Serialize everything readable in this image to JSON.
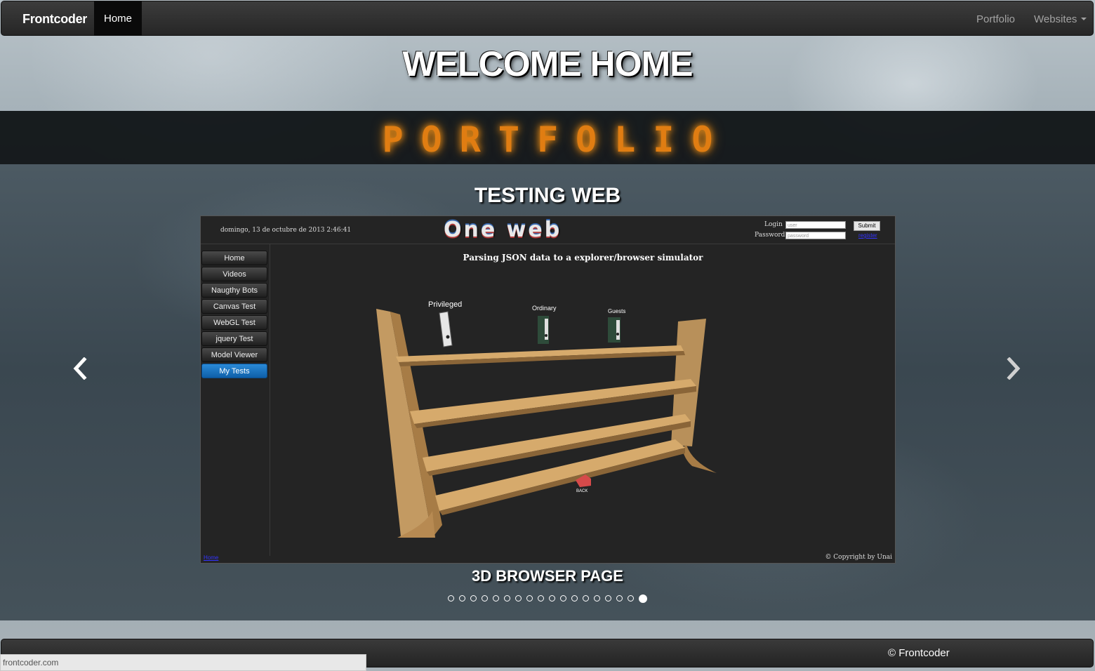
{
  "navbar": {
    "brand": "Frontcoder",
    "home": "Home",
    "portfolio": "Portfolio",
    "websites": "Websites"
  },
  "hero": {
    "welcome": "WELCOME HOME",
    "portfolio": "PORTFOLIO"
  },
  "carousel": {
    "slide_title": "TESTING WEB",
    "caption": "3D BROWSER PAGE",
    "prev_glyph": "‹",
    "next_glyph": "›",
    "total_slides": 18,
    "active_slide": 18
  },
  "inner_page": {
    "date": "domingo, 13 de octubre de 2013 2:46:41",
    "logo": "One web",
    "login_label": "Login",
    "password_label": "Password",
    "user_placeholder": "user",
    "password_placeholder": "password",
    "submit": "Submit",
    "register": "register",
    "menu": [
      "Home",
      "Videos",
      "Naugthy Bots",
      "Canvas Test",
      "WebGL Test",
      "jquery Test",
      "Model Viewer",
      "My Tests"
    ],
    "active_menu": "My Tests",
    "heading": "Parsing JSON data to a explorer/browser simulator",
    "shelf_labels": [
      "Privileged",
      "Ordinary",
      "Guests"
    ],
    "back_label": "BACK",
    "home_link": "Home",
    "copyright": "© Copyright by Unai"
  },
  "footer": {
    "copyright": "© Frontcoder"
  },
  "status_bar": {
    "url": "frontcoder.com"
  },
  "colors": {
    "accent_orange": "#e07d12",
    "active_blue": "#1a7bc8",
    "navbar_dark": "#262626"
  }
}
